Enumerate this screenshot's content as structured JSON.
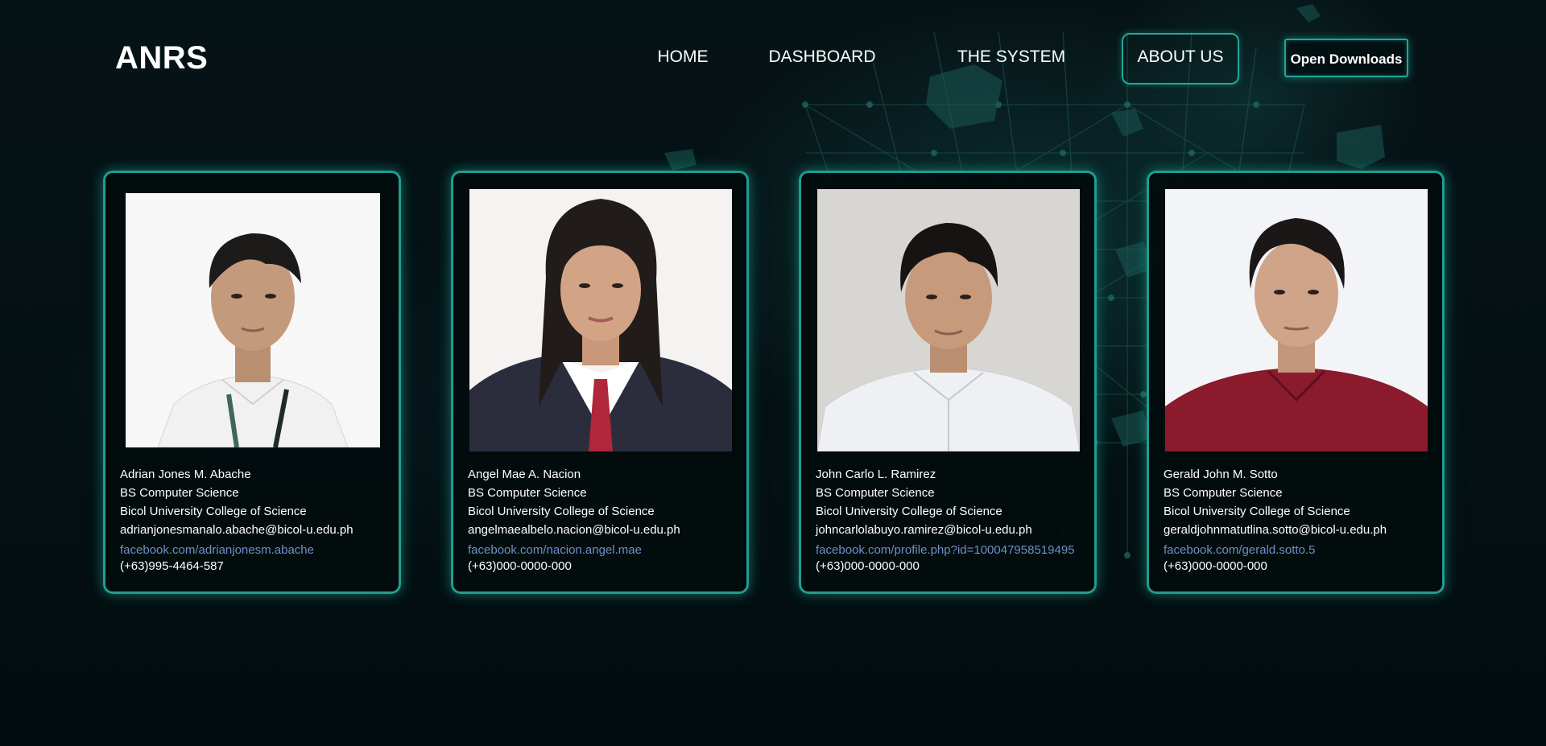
{
  "app": {
    "logo": "ANRS",
    "accent_color": "#22a79a",
    "link_color": "#6f8fc7"
  },
  "nav": {
    "items": [
      {
        "label": "HOME",
        "active": false
      },
      {
        "label": "DASHBOARD",
        "active": false
      },
      {
        "label": "THE SYSTEM",
        "active": false
      },
      {
        "label": "ABOUT US",
        "active": true
      }
    ],
    "download_label": "Open Downloads"
  },
  "members": [
    {
      "name": "Adrian Jones M. Abache",
      "course": "BS Computer Science",
      "school": "Bicol University College of Science",
      "email": "adrianjonesmanalo.abache@bicol-u.edu.ph",
      "facebook": "facebook.com/adrianjonesm.abache",
      "phone": "(+63)995-4464-587",
      "photo_icon": "person-photo-icon"
    },
    {
      "name": "Angel Mae A. Nacion",
      "course": "BS Computer Science",
      "school": "Bicol University College of Science",
      "email": "angelmaealbelo.nacion@bicol-u.edu.ph",
      "facebook": "facebook.com/nacion.angel.mae",
      "phone": "(+63)000-0000-000",
      "photo_icon": "person-photo-icon"
    },
    {
      "name": "John Carlo L. Ramirez",
      "course": "BS Computer Science",
      "school": "Bicol University College of Science",
      "email": "johncarlolabuyo.ramirez@bicol-u.edu.ph",
      "facebook": "facebook.com/profile.php?id=100047958519495",
      "phone": "(+63)000-0000-000",
      "photo_icon": "person-photo-icon"
    },
    {
      "name": "Gerald John M. Sotto",
      "course": "BS Computer Science",
      "school": "Bicol University College of Science",
      "email": "geraldjohnmatutlina.sotto@bicol-u.edu.ph",
      "facebook": "facebook.com/gerald.sotto.5",
      "phone": "(+63)000-0000-000",
      "photo_icon": "person-photo-icon"
    }
  ]
}
